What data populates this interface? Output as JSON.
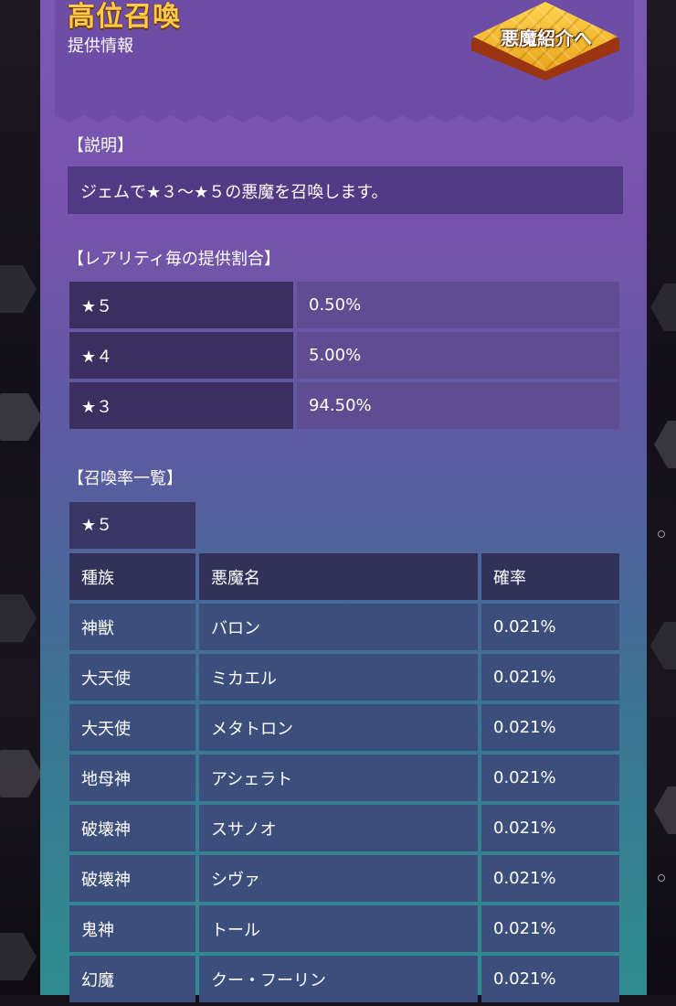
{
  "header": {
    "title": "高位召喚",
    "subtitle": "提供情報",
    "intro_button": "悪魔紹介へ"
  },
  "description": {
    "heading": "【説明】",
    "text": "ジェムで★３〜★５の悪魔を召喚します。"
  },
  "rarity_rates": {
    "heading": "【レアリティ毎の提供割合】",
    "rows": [
      {
        "rarity": "★５",
        "rate": "0.50%"
      },
      {
        "rarity": "★４",
        "rate": "5.00%"
      },
      {
        "rarity": "★３",
        "rate": "94.50%"
      }
    ]
  },
  "summon_rates": {
    "heading": "【召喚率一覧】",
    "tier_tab": "★５",
    "columns": [
      "種族",
      "悪魔名",
      "確率"
    ],
    "rows": [
      {
        "race": "神獣",
        "name": "バロン",
        "rate": "0.021%"
      },
      {
        "race": "大天使",
        "name": "ミカエル",
        "rate": "0.021%"
      },
      {
        "race": "大天使",
        "name": "メタトロン",
        "rate": "0.021%"
      },
      {
        "race": "地母神",
        "name": "アシェラト",
        "rate": "0.021%"
      },
      {
        "race": "破壊神",
        "name": "スサノオ",
        "rate": "0.021%"
      },
      {
        "race": "破壊神",
        "name": "シヴァ",
        "rate": "0.021%"
      },
      {
        "race": "鬼神",
        "name": "トール",
        "rate": "0.021%"
      },
      {
        "race": "幻魔",
        "name": "クー・フーリン",
        "rate": "0.021%"
      }
    ]
  },
  "colors": {
    "title_gold": "#ffc94a",
    "panel_top": "#7a58b5",
    "panel_bottom": "#2f8d8f"
  }
}
